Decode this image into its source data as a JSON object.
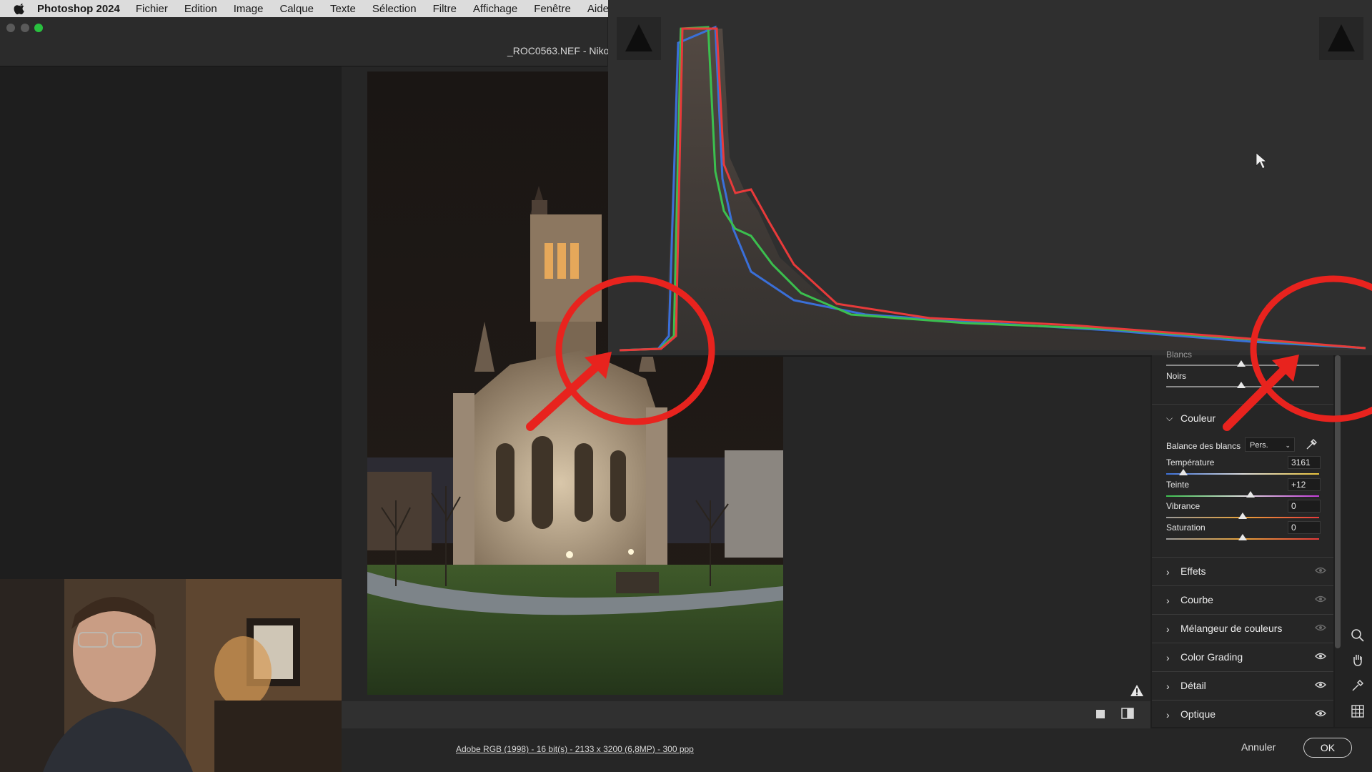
{
  "menubar": {
    "app_name": "Photoshop 2024",
    "items": [
      "Fichier",
      "Edition",
      "Image",
      "Calque",
      "Texte",
      "Sélection",
      "Filtre",
      "Affichage",
      "Fenêtre",
      "Aide"
    ]
  },
  "window": {
    "title": "_ROC0563.NEF  -  Niko"
  },
  "panel": {
    "tone": {
      "blancs_label": "Blancs",
      "noirs_label": "Noirs"
    },
    "couleur": {
      "title": "Couleur",
      "wb_label": "Balance des blancs",
      "wb_value": "Pers.",
      "sliders": [
        {
          "label": "Température",
          "value": "3161",
          "level": 0.11
        },
        {
          "label": "Teinte",
          "value": "+12",
          "level": 0.55
        },
        {
          "label": "Vibrance",
          "value": "0",
          "level": 0.5
        },
        {
          "label": "Saturation",
          "value": "0",
          "level": 0.5
        }
      ]
    },
    "sections": [
      {
        "title": "Effets"
      },
      {
        "title": "Courbe"
      },
      {
        "title": "Mélangeur de couleurs"
      },
      {
        "title": "Color Grading"
      },
      {
        "title": "Détail"
      },
      {
        "title": "Optique"
      }
    ]
  },
  "footer": {
    "workflow_link": "Adobe RGB (1998) - 16 bit(s) - 2133 x 3200 (6,8MP) - 300 ppp",
    "cancel": "Annuler",
    "ok": "OK"
  },
  "colors": {
    "accent_red": "#e8231e",
    "histogram_red": "#e83a3a",
    "histogram_green": "#3bbf4e",
    "histogram_blue": "#3a6fd8"
  }
}
